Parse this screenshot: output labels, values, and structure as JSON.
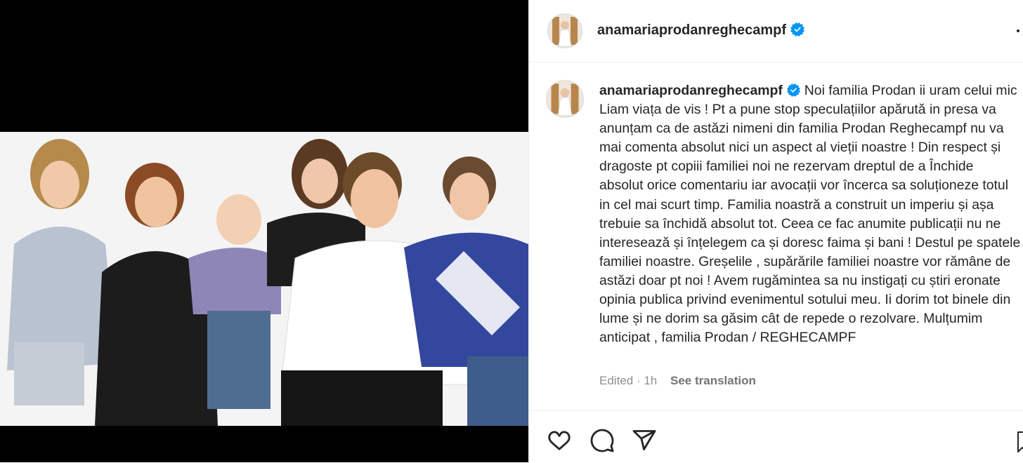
{
  "post": {
    "username": "anamariaprodanreghecampf",
    "verified": true,
    "caption": "Noi familia Prodan ii uram celui mic Liam viața de vis ! Pt a pune stop speculațiilor apărută in presa va anunțam ca de astăzi nimeni din familia Prodan Reghecampf nu va mai comenta absolut nici un aspect al vieții noastre ! Din respect și dragoste pt copiii familiei noi ne rezervam dreptul de a Închide absolut orice comentariu iar avocații vor încerca sa soluționeze totul in cel mai scurt timp. Familia noastră a construit un imperiu și așa trebuie sa închidă absolut tot. Ceea ce fac anumite publicații nu ne interesează și înțelegem ca și doresc faima și bani ! Destul pe spatele familiei noastre. Greșelile , supărările familiei noastre vor rămâne de astăzi doar pt noi ! Avem rugămintea sa nu instigați cu știri eronate opinia publica privind evenimentul sotului meu. Ii dorim tot binele din lume și ne dorim sa găsim cât de repede o rezolvare. Mulțumim anticipat , familia Prodan / REGHECAMPF",
    "edited_label": "Edited",
    "separator": "·",
    "time": "1h",
    "see_translation": "See translation"
  },
  "icons": {
    "like": "heart-icon",
    "comment": "comment-icon",
    "share": "share-icon",
    "save": "bookmark-icon",
    "more": "more-dots-icon",
    "verified": "verified-badge-icon"
  },
  "colors": {
    "verified_blue": "#0095f6",
    "text": "#262626",
    "muted": "#8e8e8e",
    "media_bg": "#000000"
  }
}
